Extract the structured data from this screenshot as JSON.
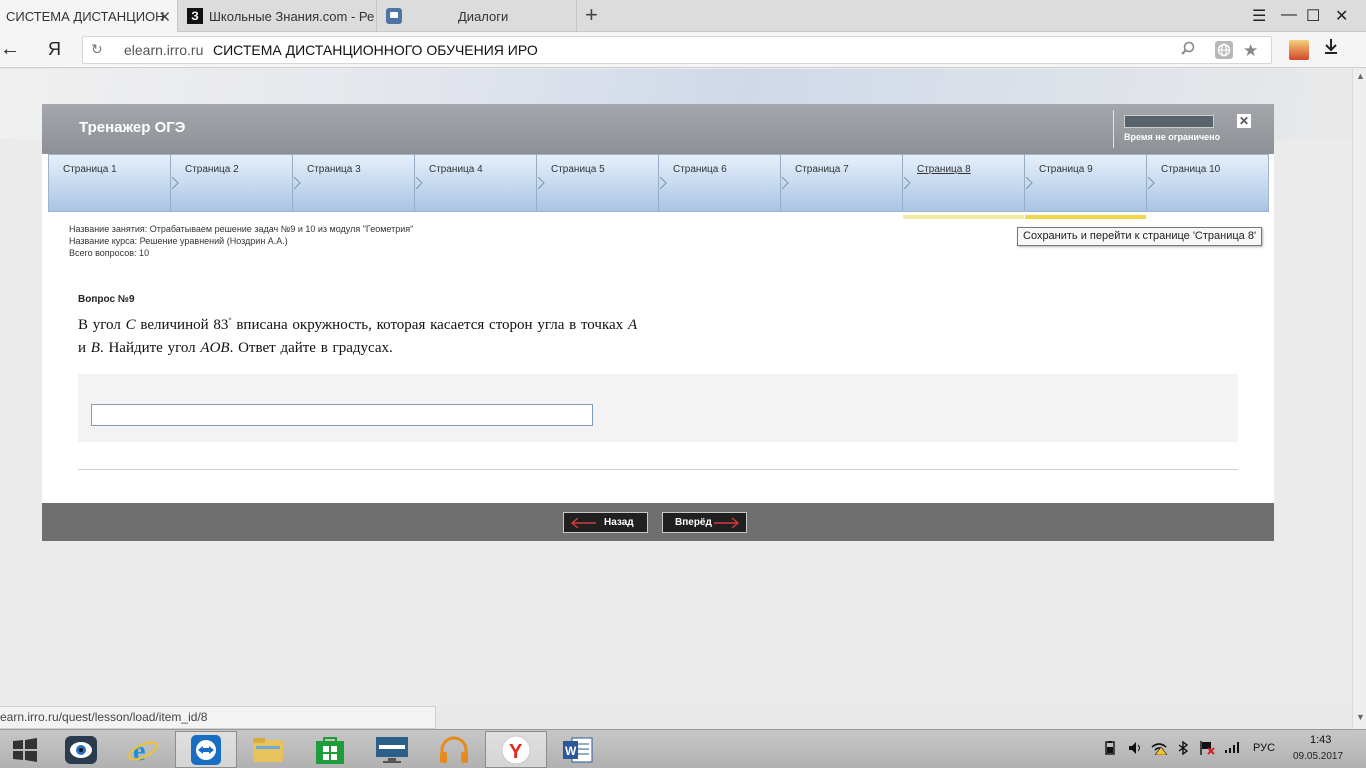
{
  "browser": {
    "tabs": [
      {
        "label": "СИСТЕМА ДИСТАНЦИОН",
        "close": "✕"
      },
      {
        "label": "Школьные Знания.com - Ре",
        "icon_text": "З"
      },
      {
        "label": "Диалоги"
      }
    ],
    "new_tab": "+",
    "window_controls": {
      "menu": "☰",
      "minimize": "—",
      "maximize": "☐",
      "close": "✕"
    },
    "back": "←",
    "yandex_logo": "Я",
    "reload": "↻",
    "url_domain": "elearn.irro.ru",
    "url_title": "СИСТЕМА ДИСТАНЦИОННОГО ОБУЧЕНИЯ ИРО",
    "status_url": "earn.irro.ru/quest/lesson/load/item_id/8"
  },
  "app": {
    "title": "Тренажер ОГЭ",
    "timer_label": "Время не ограничено",
    "close": "✕",
    "pages": [
      {
        "label": "Страница 1"
      },
      {
        "label": "Страница 2"
      },
      {
        "label": "Страница 3"
      },
      {
        "label": "Страница 4"
      },
      {
        "label": "Страница 5"
      },
      {
        "label": "Страница 6"
      },
      {
        "label": "Страница 7"
      },
      {
        "label": "Страница 8"
      },
      {
        "label": "Страница 9"
      },
      {
        "label": "Страница 10"
      }
    ],
    "tooltip": "Сохранить и перейти к странице 'Страница 8'",
    "info": {
      "lesson": "Название занятия: Отрабатываем решение задач №9 и 10 из модуля \"Геометрия\"",
      "course": "Название курса: Решение уравнений (Ноздрин А.А.)",
      "total": "Всего вопросов: 10"
    },
    "question": {
      "heading": "Вопрос №9",
      "t1": "В угол ",
      "v1": "C",
      "t2": " величиной 83",
      "deg": "°",
      "t3": " вписана окружность, которая касается сторон угла в точках ",
      "v2": "A",
      "t4": " и ",
      "v3": "B",
      "t5": ". Найдите угол ",
      "v4": "AOB",
      "t6": ". Ответ дайте в градусах."
    },
    "answer_value": "",
    "nav": {
      "back": "Назад",
      "forward": "Вперёд"
    }
  },
  "taskbar": {
    "lang": "РУС",
    "time": "1:43",
    "date": "09.05.2017",
    "yandex_letter": "Y",
    "word_letter": "W"
  },
  "colors": {
    "header_gray": "#8d9094",
    "tab_blue": "#a9c5e4",
    "current_underline": "#efd84a",
    "footer_gray": "#6f6f6f"
  }
}
